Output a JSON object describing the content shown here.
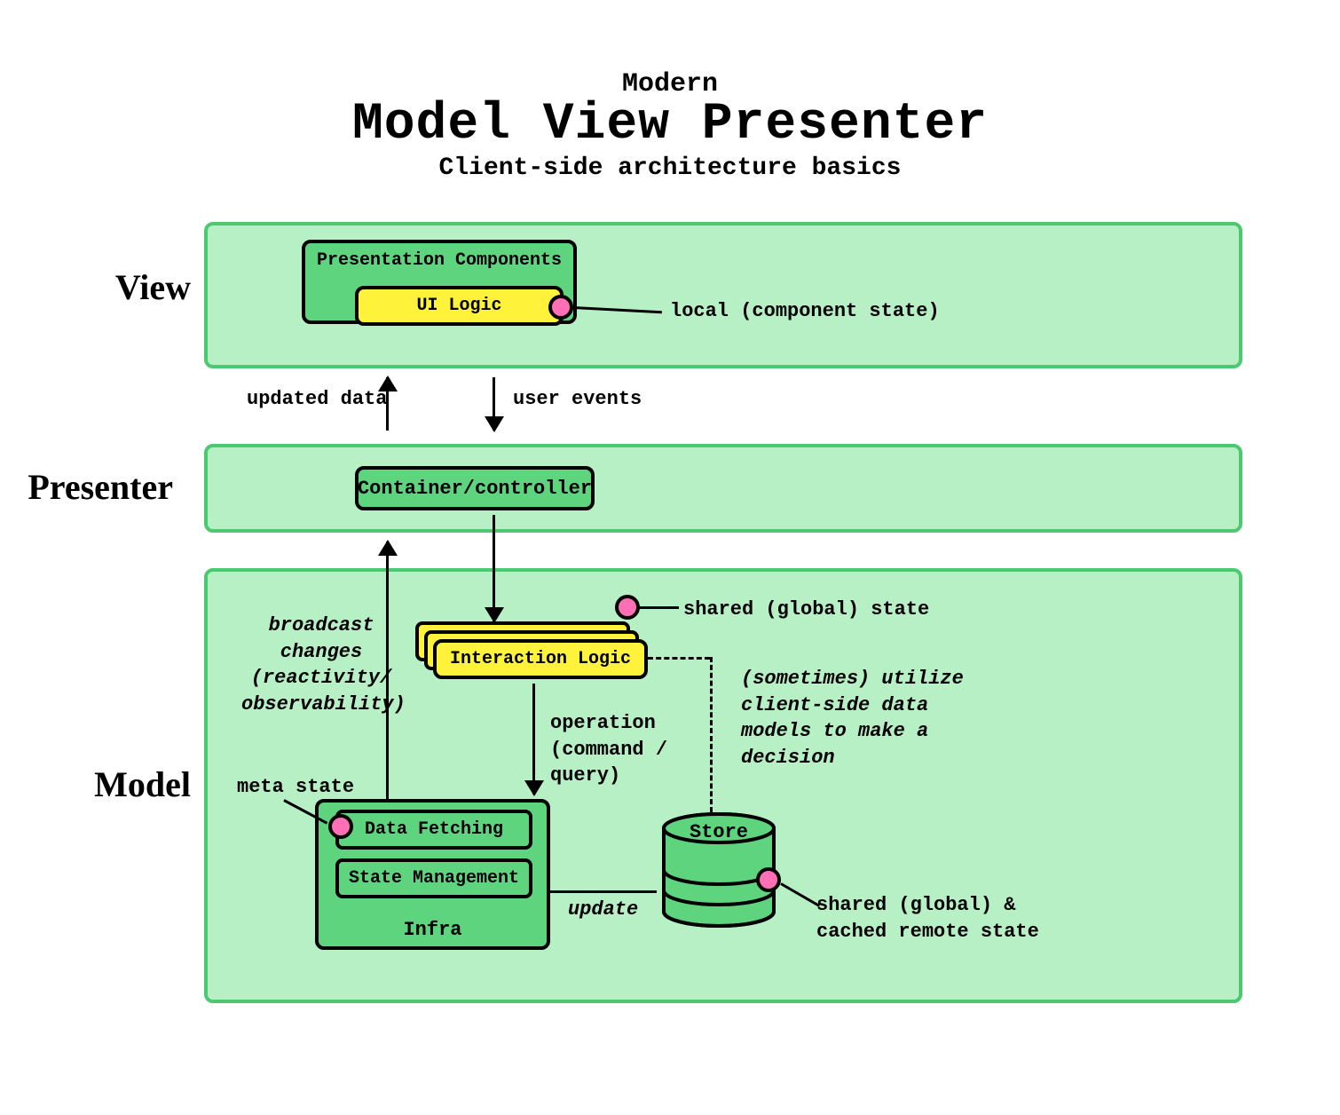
{
  "header": {
    "pretitle": "Modern",
    "title": "Model View Presenter",
    "subtitle": "Client-side architecture basics"
  },
  "layers": {
    "view": {
      "label": "View"
    },
    "presenter": {
      "label": "Presenter"
    },
    "model": {
      "label": "Model"
    }
  },
  "boxes": {
    "presentation": "Presentation Components",
    "ui_logic": "UI Logic",
    "controller": "Container/controller",
    "interaction": "Interaction Logic",
    "data_fetching": "Data Fetching",
    "state_management": "State Management",
    "infra": "Infra",
    "store": "Store"
  },
  "notes": {
    "local_state": "local (component state)",
    "user_events": "user events",
    "updated_data": "updated data",
    "broadcast": "broadcast changes (reactivity/ observability)",
    "shared_global": "shared (global) state",
    "operation": "operation (command / query)",
    "sometimes": "(sometimes) utilize client-side data models to make a decision",
    "meta_state": "meta state",
    "update": "update",
    "shared_cached": "shared (global) & cached remote state"
  },
  "colors": {
    "panel_fill": "#b7f0c4",
    "panel_border": "#4bc970",
    "box_green": "#5fd47e",
    "box_yellow": "#fff23a",
    "dot_pink": "#ff6fb5"
  }
}
